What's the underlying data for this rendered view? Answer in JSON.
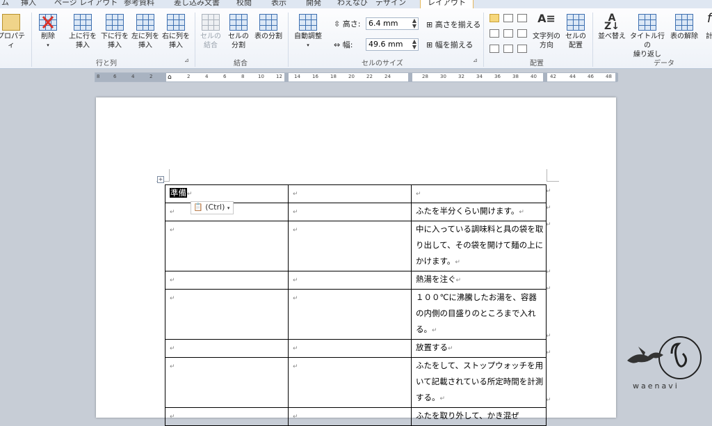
{
  "tabs": [
    "ム",
    "挿入",
    "ページ レイアウト",
    "参考資料",
    "差し込み文書",
    "校閲",
    "表示",
    "開発",
    "わえなび",
    "デザイン",
    "レイアウト"
  ],
  "ribbon": {
    "properties": "プロパティ",
    "delete": "削除",
    "insert_above": "上に行を\n挿入",
    "insert_below": "下に行を\n挿入",
    "insert_left": "左に列を\n挿入",
    "insert_right": "右に列を\n挿入",
    "group_rows_cols": "行と列",
    "merge_cells": "セルの\n結合",
    "split_cells": "セルの\n分割",
    "split_table": "表の分割",
    "group_merge": "結合",
    "autofit": "自動調整",
    "height_label": "高さ:",
    "height_value": "6.4 mm",
    "width_label": "幅:",
    "width_value": "49.6 mm",
    "distribute_rows": "高さを揃える",
    "distribute_cols": "幅を揃える",
    "group_cell_size": "セルのサイズ",
    "text_direction": "文字列の\n方向",
    "cell_margins": "セルの\n配置",
    "group_alignment": "配置",
    "sort": "並べ替え",
    "repeat_header": "タイトル行の\n繰り返し",
    "convert_text": "表の解除",
    "formula": "計",
    "group_data": "データ"
  },
  "ruler_ticks": [
    "8",
    "6",
    "4",
    "2",
    "2",
    "4",
    "6",
    "8",
    "10",
    "12",
    "14",
    "16",
    "18",
    "20",
    "22",
    "24",
    "28",
    "30",
    "32",
    "34",
    "36",
    "38",
    "40",
    "42",
    "44",
    "46",
    "48"
  ],
  "paste_options": "(Ctrl)",
  "table": {
    "rows": [
      {
        "c1": "準備",
        "c2": "",
        "c3": ""
      },
      {
        "c1": "",
        "c2": "",
        "c3": "ふたを半分くらい開けます。"
      },
      {
        "c1": "",
        "c2": "",
        "c3": "中に入っている調味料と具の袋を取り出して、その袋を開けて麺の上にかけます。"
      },
      {
        "c1": "",
        "c2": "",
        "c3": "熱湯を注ぐ"
      },
      {
        "c1": "",
        "c2": "",
        "c3": "１００℃に沸騰したお湯を、容器の内側の目盛りのところまで入れる。"
      },
      {
        "c1": "",
        "c2": "",
        "c3": "放置する"
      },
      {
        "c1": "",
        "c2": "",
        "c3": "ふたをして、ストップウォッチを用いて記載されている所定時間を計測する。"
      },
      {
        "c1": "",
        "c2": "",
        "c3": "ふたを取り外して、かき混ぜ"
      }
    ]
  },
  "watermark": "waenavi",
  "colors": {
    "accent": "#e6b85a",
    "ribbon_blue": "#3d6fb0"
  }
}
